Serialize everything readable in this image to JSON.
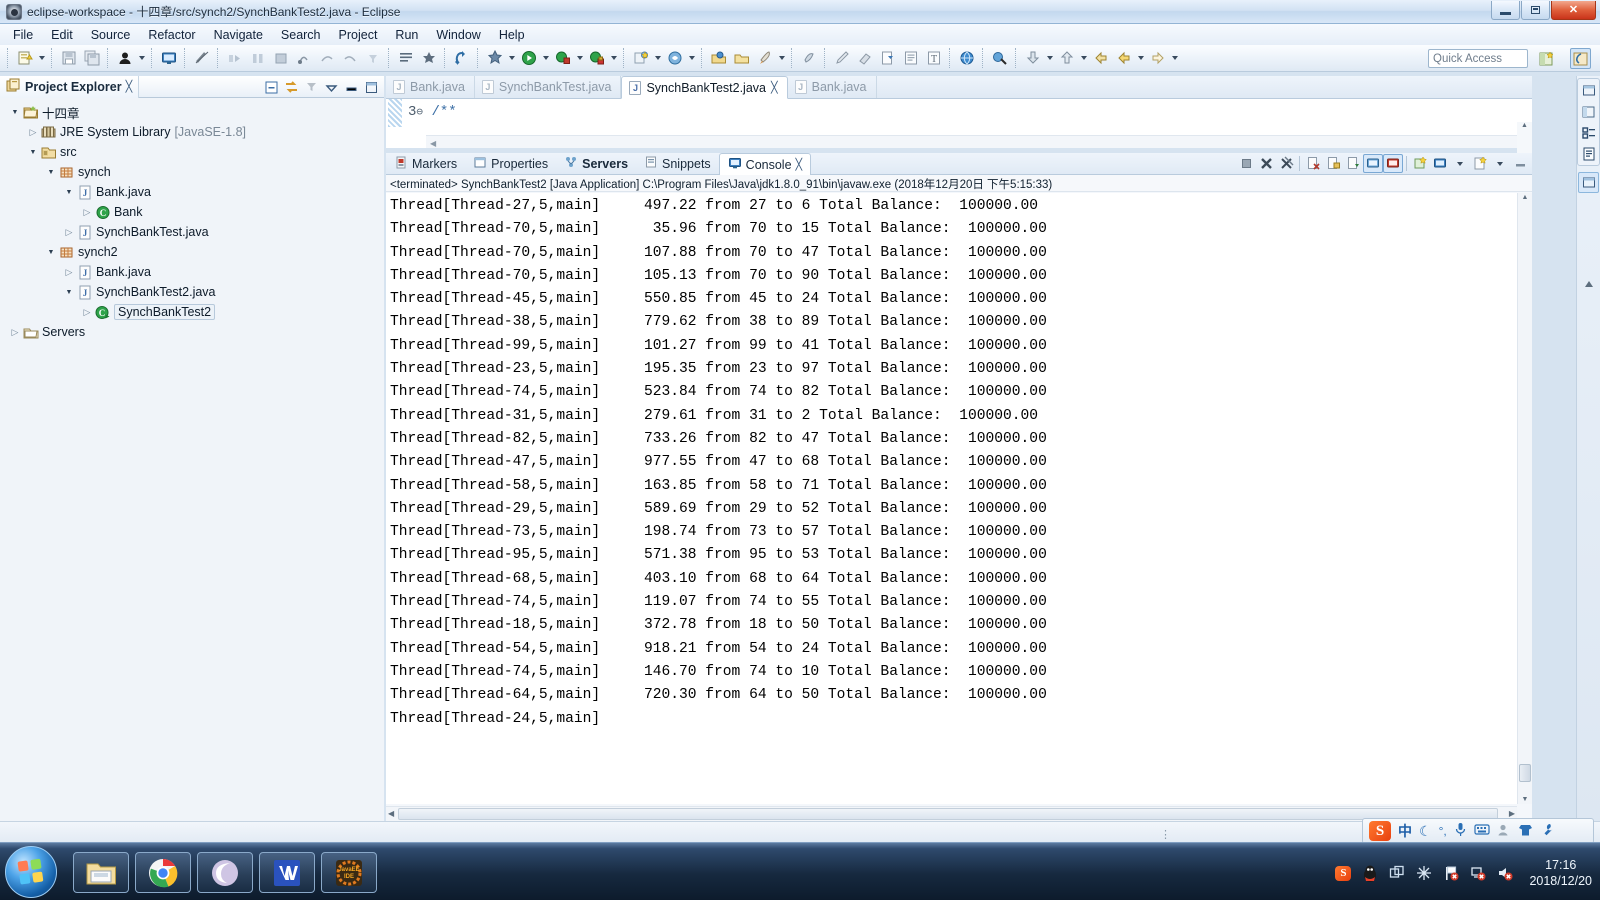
{
  "window": {
    "title": "eclipse-workspace - 十四章/src/synch2/SynchBankTest2.java - Eclipse",
    "app_icon": "eclipse-icon",
    "minimize": "minimize-icon",
    "maximize": "restore-icon",
    "close": "close-icon"
  },
  "menubar": {
    "items": [
      "File",
      "Edit",
      "Source",
      "Refactor",
      "Navigate",
      "Search",
      "Project",
      "Run",
      "Window",
      "Help"
    ]
  },
  "toolbar": {
    "quick_access_placeholder": "Quick Access",
    "icons": [
      "new-wizard-icon",
      "new-dropdown-arrow",
      "save-icon",
      "save-all-icon",
      "person-icon",
      "person-dropdown-arrow",
      "open-console-icon",
      "toggle-mark-occurrences-icon",
      "skip-breakpoints-icon",
      "step-over-icon",
      "terminate-icon",
      "debug-step-icon",
      "resume-icon",
      "step-return-icon",
      "step-filters-icon",
      "annotation-icon",
      "external-tools-icon",
      "new-java-class-icon",
      "new-java-project-icon",
      "run-icon",
      "run-dropdown-arrow",
      "debug-icon",
      "debug-dropdown-arrow",
      "coverage-icon",
      "coverage-dropdown-arrow",
      "new-wizard2-icon",
      "new-wizard2-arrow",
      "search-icon",
      "search-arrow",
      "open-type-icon",
      "open-resource-icon",
      "launch-icon",
      "launch-arrow",
      "pin-icon",
      "pencil-icon",
      "eraser-icon",
      "export-icon",
      "outline-icon",
      "format-icon",
      "web-browser-icon",
      "link-icon",
      "download-icon",
      "download-arrow",
      "upload-icon",
      "upload-arrow",
      "back-icon",
      "back-yellow-icon",
      "back-arrow",
      "forward-icon",
      "forward-arrow",
      "perspective-new-icon",
      "java-perspective-icon"
    ]
  },
  "explorer": {
    "tab_title": "Project Explorer",
    "tab_close": "close-icon",
    "tools": [
      "collapse-all-icon",
      "link-with-editor-icon",
      "view-menu-icon",
      "minimize-icon",
      "maximize-icon"
    ],
    "tree": [
      {
        "indent": 0,
        "twisty": "expanded",
        "icon": "project-folder-icon",
        "label": "十四章",
        "dim": "",
        "selected": false
      },
      {
        "indent": 1,
        "twisty": "collapsed",
        "icon": "jre-library-icon",
        "label": "JRE System Library",
        "dim": "[JavaSE-1.8]",
        "selected": false
      },
      {
        "indent": 1,
        "twisty": "expanded",
        "icon": "source-folder-icon",
        "label": "src",
        "dim": "",
        "selected": false
      },
      {
        "indent": 2,
        "twisty": "expanded",
        "icon": "package-icon",
        "label": "synch",
        "dim": "",
        "selected": false
      },
      {
        "indent": 3,
        "twisty": "expanded",
        "icon": "java-file-icon",
        "label": "Bank.java",
        "dim": "",
        "selected": false
      },
      {
        "indent": 4,
        "twisty": "collapsed",
        "icon": "java-class-icon",
        "label": "Bank",
        "dim": "",
        "selected": false
      },
      {
        "indent": 3,
        "twisty": "collapsed",
        "icon": "java-file-icon",
        "label": "SynchBankTest.java",
        "dim": "",
        "selected": false
      },
      {
        "indent": 2,
        "twisty": "expanded",
        "icon": "package-icon",
        "label": "synch2",
        "dim": "",
        "selected": false
      },
      {
        "indent": 3,
        "twisty": "collapsed",
        "icon": "java-file-icon",
        "label": "Bank.java",
        "dim": "",
        "selected": false
      },
      {
        "indent": 3,
        "twisty": "expanded",
        "icon": "java-file-icon",
        "label": "SynchBankTest2.java",
        "dim": "",
        "selected": false
      },
      {
        "indent": 4,
        "twisty": "collapsed",
        "icon": "java-runnable-class-icon",
        "label": "SynchBankTest2",
        "dim": "",
        "selected": true
      },
      {
        "indent": 0,
        "twisty": "collapsed",
        "icon": "servers-folder-icon",
        "label": "Servers",
        "dim": "",
        "selected": false
      }
    ]
  },
  "editor": {
    "tabs": [
      {
        "label": "Bank.java",
        "active": false,
        "closeable": false
      },
      {
        "label": "SynchBankTest.java",
        "active": false,
        "closeable": false
      },
      {
        "label": "SynchBankTest2.java",
        "active": true,
        "closeable": true
      },
      {
        "label": "Bank.java",
        "active": false,
        "closeable": false
      }
    ],
    "line_number": "3",
    "fold_marker": "⊖",
    "code_text": "/**"
  },
  "console": {
    "tabs": [
      {
        "label": "Markers",
        "icon": "markers-icon",
        "active": false,
        "bold": false
      },
      {
        "label": "Properties",
        "icon": "properties-icon",
        "active": false,
        "bold": false
      },
      {
        "label": "Servers",
        "icon": "servers-icon",
        "active": false,
        "bold": true
      },
      {
        "label": "Snippets",
        "icon": "snippets-icon",
        "active": false,
        "bold": false
      },
      {
        "label": "Console",
        "icon": "console-icon",
        "active": true,
        "bold": false
      }
    ],
    "tab_close": "close-icon",
    "tools": [
      "terminate-icon",
      "remove-launch-icon",
      "remove-all-terminated-icon",
      "clear-console-icon",
      "scroll-lock-icon",
      "show-console-on-output-icon",
      "pin-console-icon",
      "display-selected-console-icon",
      "open-console-icon",
      "open-console-arrow",
      "new-console-view-icon",
      "new-console-arrow",
      "minimize-icon"
    ],
    "status_line": "<terminated> SynchBankTest2 [Java Application] C:\\Program Files\\Java\\jdk1.8.0_91\\bin\\javaw.exe (2018年12月20日 下午5:15:33)",
    "lines": [
      "Thread[Thread-27,5,main]     497.22 from 27 to 6 Total Balance:  100000.00",
      "Thread[Thread-70,5,main]      35.96 from 70 to 15 Total Balance:  100000.00",
      "Thread[Thread-70,5,main]     107.88 from 70 to 47 Total Balance:  100000.00",
      "Thread[Thread-70,5,main]     105.13 from 70 to 90 Total Balance:  100000.00",
      "Thread[Thread-45,5,main]     550.85 from 45 to 24 Total Balance:  100000.00",
      "Thread[Thread-38,5,main]     779.62 from 38 to 89 Total Balance:  100000.00",
      "Thread[Thread-99,5,main]     101.27 from 99 to 41 Total Balance:  100000.00",
      "Thread[Thread-23,5,main]     195.35 from 23 to 97 Total Balance:  100000.00",
      "Thread[Thread-74,5,main]     523.84 from 74 to 82 Total Balance:  100000.00",
      "Thread[Thread-31,5,main]     279.61 from 31 to 2 Total Balance:  100000.00",
      "Thread[Thread-82,5,main]     733.26 from 82 to 47 Total Balance:  100000.00",
      "Thread[Thread-47,5,main]     977.55 from 47 to 68 Total Balance:  100000.00",
      "Thread[Thread-58,5,main]     163.85 from 58 to 71 Total Balance:  100000.00",
      "Thread[Thread-29,5,main]     589.69 from 29 to 52 Total Balance:  100000.00",
      "Thread[Thread-73,5,main]     198.74 from 73 to 57 Total Balance:  100000.00",
      "Thread[Thread-95,5,main]     571.38 from 95 to 53 Total Balance:  100000.00",
      "Thread[Thread-68,5,main]     403.10 from 68 to 64 Total Balance:  100000.00",
      "Thread[Thread-74,5,main]     119.07 from 74 to 55 Total Balance:  100000.00",
      "Thread[Thread-18,5,main]     372.78 from 18 to 50 Total Balance:  100000.00",
      "Thread[Thread-54,5,main]     918.21 from 54 to 24 Total Balance:  100000.00",
      "Thread[Thread-74,5,main]     146.70 from 74 to 10 Total Balance:  100000.00",
      "Thread[Thread-64,5,main]     720.30 from 64 to 50 Total Balance:  100000.00",
      "Thread[Thread-24,5,main]"
    ]
  },
  "rightbar": {
    "icons": [
      "restore-perspective-icon",
      "java-perspective-icon",
      "java-ee-perspective-icon",
      "outline-view-icon",
      "console-view-icon"
    ]
  },
  "imebar": {
    "icons": [
      "sogou-logo-icon",
      "chinese-mode-icon",
      "moon-icon",
      "punctuation-icon",
      "microphone-icon",
      "keyboard-icon",
      "user-icon",
      "skin-icon",
      "toolbox-icon"
    ],
    "mode_label": "中",
    "punct_label": "°,"
  },
  "taskbar": {
    "start": "windows-start-orb",
    "items": [
      {
        "icon": "file-explorer-icon",
        "name": "file-explorer"
      },
      {
        "icon": "chrome-icon",
        "name": "google-chrome"
      },
      {
        "icon": "foxit-reader-icon",
        "name": "media-player"
      },
      {
        "icon": "wps-writer-icon",
        "name": "wps-writer"
      },
      {
        "icon": "eclipse-javaee-icon",
        "name": "eclipse-ide"
      }
    ],
    "tray": [
      "sogou-icon",
      "qq-penguin-icon",
      "windows-tile-icon",
      "snowflake-icon",
      "flag-error-icon",
      "network-error-icon",
      "volume-mute-icon"
    ],
    "clock_time": "17:16",
    "clock_date": "2018/12/20"
  },
  "colors": {
    "accent": "#3a6ea5",
    "titlebar_close": "#c9341a",
    "console_bg": "#ffffff",
    "selection": "#cde2f8"
  }
}
